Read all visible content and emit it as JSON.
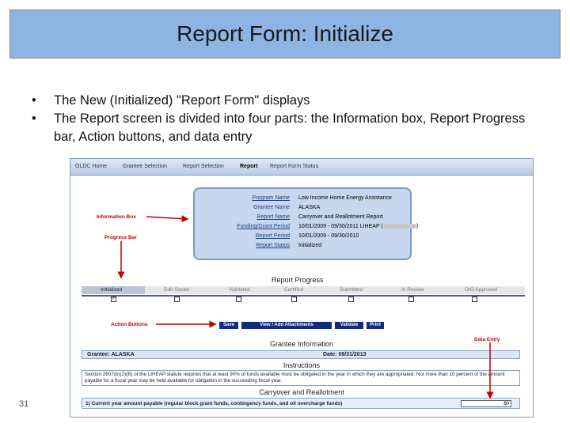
{
  "slide": {
    "title": "Report Form: Initialize",
    "bullets": [
      "The New (Initialized) \"Report Form\" displays",
      "The Report screen is divided into four parts: the Information box, Report Progress bar, Action buttons, and data entry"
    ],
    "page_number": "31"
  },
  "screenshot": {
    "nav": [
      "OLDC Home",
      "Grantee Selection",
      "Report Selection",
      "Report",
      "Report Form Status"
    ],
    "info_box": {
      "program_name_label": "Program Name",
      "program_name": "Low Income Home Energy Assistance",
      "grantee_name_label": "Grantee Name",
      "grantee_name": "ALASKA",
      "report_name_label": "Report Name",
      "report_name": "Carryover and Reallotment Report",
      "funding_period_label": "Funding/Grant Period",
      "funding_period": "10/01/2009 - 09/30/2011 LIHEAP (",
      "funding_period_end": ")",
      "report_period_label": "Report Period",
      "report_period": "10/01/2009 - 09/30/2010",
      "report_status_label": "Report Status",
      "report_status": "Initialized"
    },
    "progress": {
      "title": "Report Progress",
      "steps": [
        "Initialized",
        "Edit-Saved",
        "Validated",
        "Certified",
        "Submitted",
        "In Review",
        "OIO Approved"
      ],
      "current_step": "Initialized",
      "check": "✓"
    },
    "buttons": {
      "save": "Save",
      "view_add_attachments": "View / Add Attachments",
      "validate": "Validate",
      "print": "Print"
    },
    "grantee_info": {
      "title": "Grantee Information",
      "grantee": "Grantee: ALASKA",
      "date": "Date: 09/31/2013"
    },
    "instructions": {
      "title": "Instructions",
      "text": "Section 2607(b)(2)(B) of the LIHEAP statute requires that at least 90% of funds available must be obligated in the year in which they are appropriated. Not more than 10 percent of the amount payable for a fiscal year may be held available for obligation in the succeeding fiscal year."
    },
    "carryover": {
      "title": "Carryover and Reallotment",
      "item1": "1) Current year amount payable (regular block grant funds, contingency funds, and oil overcharge funds)",
      "item1_value": "$0"
    },
    "annotations": {
      "information_box": "Information Box",
      "progress_bar": "Progress Bar",
      "action_buttons": "Action Buttons",
      "data_entry": "Data Entry"
    }
  },
  "colors": {
    "title_bg": "#8db4e2",
    "info_box_bg": "#c7d7ef",
    "button_bg": "#122a7a",
    "annotation": "#c00000"
  }
}
